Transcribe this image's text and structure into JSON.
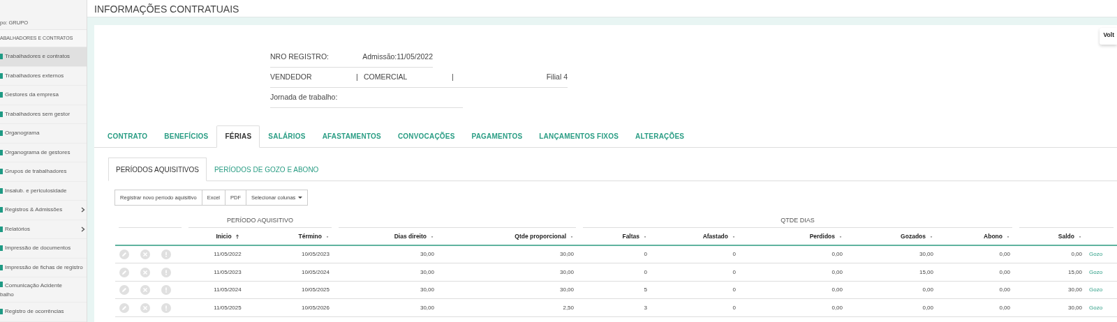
{
  "sidebar": {
    "group_label": "po: GRUPO",
    "section": "ABALHADORES E CONTRATOS",
    "items": [
      {
        "label": "Trabalhadores e contratos",
        "selected": true,
        "expandable": false
      },
      {
        "label": "Trabalhadores externos",
        "selected": false,
        "expandable": false
      },
      {
        "label": "Gestores da empresa",
        "selected": false,
        "expandable": false
      },
      {
        "label": "Trabalhadores sem gestor",
        "selected": false,
        "expandable": false
      },
      {
        "label": "Organograma",
        "selected": false,
        "expandable": false
      },
      {
        "label": "Organograma de gestores",
        "selected": false,
        "expandable": false
      },
      {
        "label": "Grupos de trabalhadores",
        "selected": false,
        "expandable": false
      },
      {
        "label": "Insalub. e periculosidade",
        "selected": false,
        "expandable": false
      },
      {
        "label": "Registros & Admissões",
        "selected": false,
        "expandable": true
      },
      {
        "label": "Relatórios",
        "selected": false,
        "expandable": true
      },
      {
        "label": "Impressão de documentos",
        "selected": false,
        "expandable": false
      },
      {
        "label": "Impressão de fichas de registro",
        "selected": false,
        "expandable": false
      },
      {
        "label": "Comunicação Acidente",
        "continuation": "balho",
        "selected": false,
        "expandable": false
      },
      {
        "label": "Registro de ocorrências",
        "selected": false,
        "expandable": false
      }
    ]
  },
  "page": {
    "title": "INFORMAÇÕES CONTRATUAIS",
    "back_button": "Volt"
  },
  "info": {
    "registro_label": "NRO REGISTRO:",
    "admissao": "Admissão:11/05/2022",
    "cargo": "VENDEDOR",
    "separator_1": "|",
    "departamento": "COMERCIAL",
    "separator_2": "|",
    "filial": "Filial 4",
    "jornada_label": "Jornada de trabalho:"
  },
  "tabs": [
    {
      "label": "CONTRATO",
      "selected": false
    },
    {
      "label": "BENEFÍCIOS",
      "selected": false
    },
    {
      "label": "FÉRIAS",
      "selected": true
    },
    {
      "label": "SALÁRIOS",
      "selected": false
    },
    {
      "label": "AFASTAMENTOS",
      "selected": false
    },
    {
      "label": "CONVOCAÇÕES",
      "selected": false
    },
    {
      "label": "PAGAMENTOS",
      "selected": false
    },
    {
      "label": "LANÇAMENTOS FIXOS",
      "selected": false
    },
    {
      "label": "ALTERAÇÕES",
      "selected": false
    }
  ],
  "subtabs": [
    {
      "label": "PERÍODOS AQUISITIVOS",
      "selected": true
    },
    {
      "label": "PERÍODOS DE GOZO E ABONO",
      "selected": false
    }
  ],
  "toolbar": [
    {
      "label": "Registrar novo período aquisitivo",
      "kind": "button"
    },
    {
      "label": "Excel",
      "kind": "button"
    },
    {
      "label": "PDF",
      "kind": "button"
    },
    {
      "label": "Selecionar colunas",
      "kind": "dropdown"
    }
  ],
  "table": {
    "column_groups": [
      "PERÍODO AQUISITIVO",
      "QTDE DIAS"
    ],
    "columns": [
      {
        "label": "Inicio",
        "sorted": true
      },
      {
        "label": "Término",
        "sorted": false
      },
      {
        "label": "Dias direito",
        "sorted": false
      },
      {
        "label": "Qtde proporcional",
        "sorted": false
      },
      {
        "label": "Faltas",
        "sorted": false
      },
      {
        "label": "Afastado",
        "sorted": false
      },
      {
        "label": "Perdidos",
        "sorted": false
      },
      {
        "label": "Gozados",
        "sorted": false
      },
      {
        "label": "Abono",
        "sorted": false
      },
      {
        "label": "Saldo",
        "sorted": false
      }
    ],
    "rows": [
      {
        "cells": [
          "11/05/2022",
          "10/05/2023",
          "30,00",
          "30,00",
          "0",
          "0",
          "0,00",
          "30,00",
          "0,00",
          "0,00"
        ],
        "link": "Gozo",
        "disabled": true
      },
      {
        "cells": [
          "11/05/2023",
          "10/05/2024",
          "30,00",
          "30,00",
          "0",
          "0",
          "0,00",
          "15,00",
          "0,00",
          "15,00"
        ],
        "link": "Gozo",
        "disabled": true
      },
      {
        "cells": [
          "11/05/2024",
          "10/05/2025",
          "30,00",
          "30,00",
          "5",
          "0",
          "0,00",
          "0,00",
          "0,00",
          "30,00"
        ],
        "link": "Gozo",
        "disabled": true
      },
      {
        "cells": [
          "11/05/2025",
          "10/05/2026",
          "30,00",
          "2,50",
          "3",
          "0",
          "0,00",
          "0,00",
          "0,00",
          "30,00"
        ],
        "link": "Gozo",
        "disabled": true
      }
    ]
  }
}
